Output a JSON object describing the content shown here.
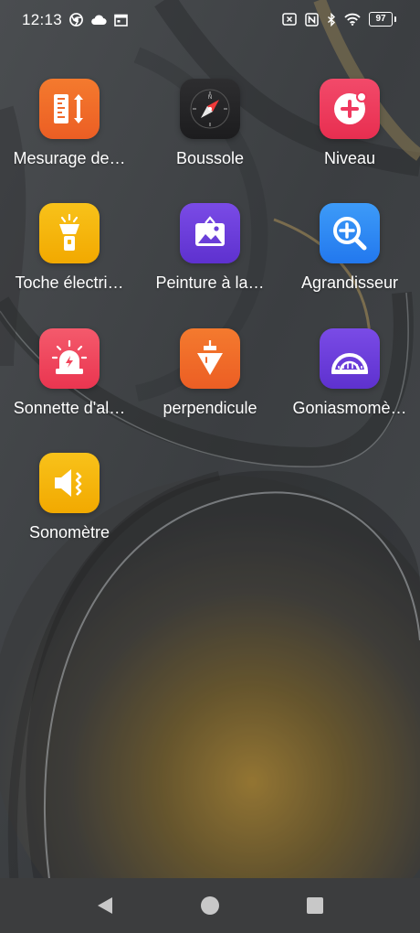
{
  "status_bar": {
    "time": "12:13",
    "battery": "97",
    "left_icons": [
      "chrome-icon",
      "cloud-icon",
      "calendar-icon"
    ],
    "right_icons": [
      "sim-icon",
      "nfc-icon",
      "bluetooth-icon",
      "wifi-icon",
      "battery-icon"
    ]
  },
  "apps": [
    {
      "label": "Mesurage de…",
      "icon": "ruler-icon",
      "color": "#f06a2c"
    },
    {
      "label": "Boussole",
      "icon": "compass-icon",
      "color": "#2a2a2c"
    },
    {
      "label": "Niveau",
      "icon": "level-icon",
      "color": "#f0395f"
    },
    {
      "label": "Toche électri…",
      "icon": "flashlight-icon",
      "color": "#f5b400"
    },
    {
      "label": "Peinture à la…",
      "icon": "painting-icon",
      "color": "#6a3fd8"
    },
    {
      "label": "Agrandisseur",
      "icon": "magnifier-icon",
      "color": "#2e8ef5"
    },
    {
      "label": "Sonnette d'al…",
      "icon": "alarm-icon",
      "color": "#f2445a"
    },
    {
      "label": "perpendicule",
      "icon": "plumb-icon",
      "color": "#f06a2c"
    },
    {
      "label": "Goniasmomè…",
      "icon": "protractor-icon",
      "color": "#6a3fd8"
    },
    {
      "label": "Sonomètre",
      "icon": "sound-meter-icon",
      "color": "#f5b400"
    }
  ],
  "nav_bar": {
    "buttons": [
      "back-icon",
      "home-icon",
      "recents-icon"
    ]
  }
}
